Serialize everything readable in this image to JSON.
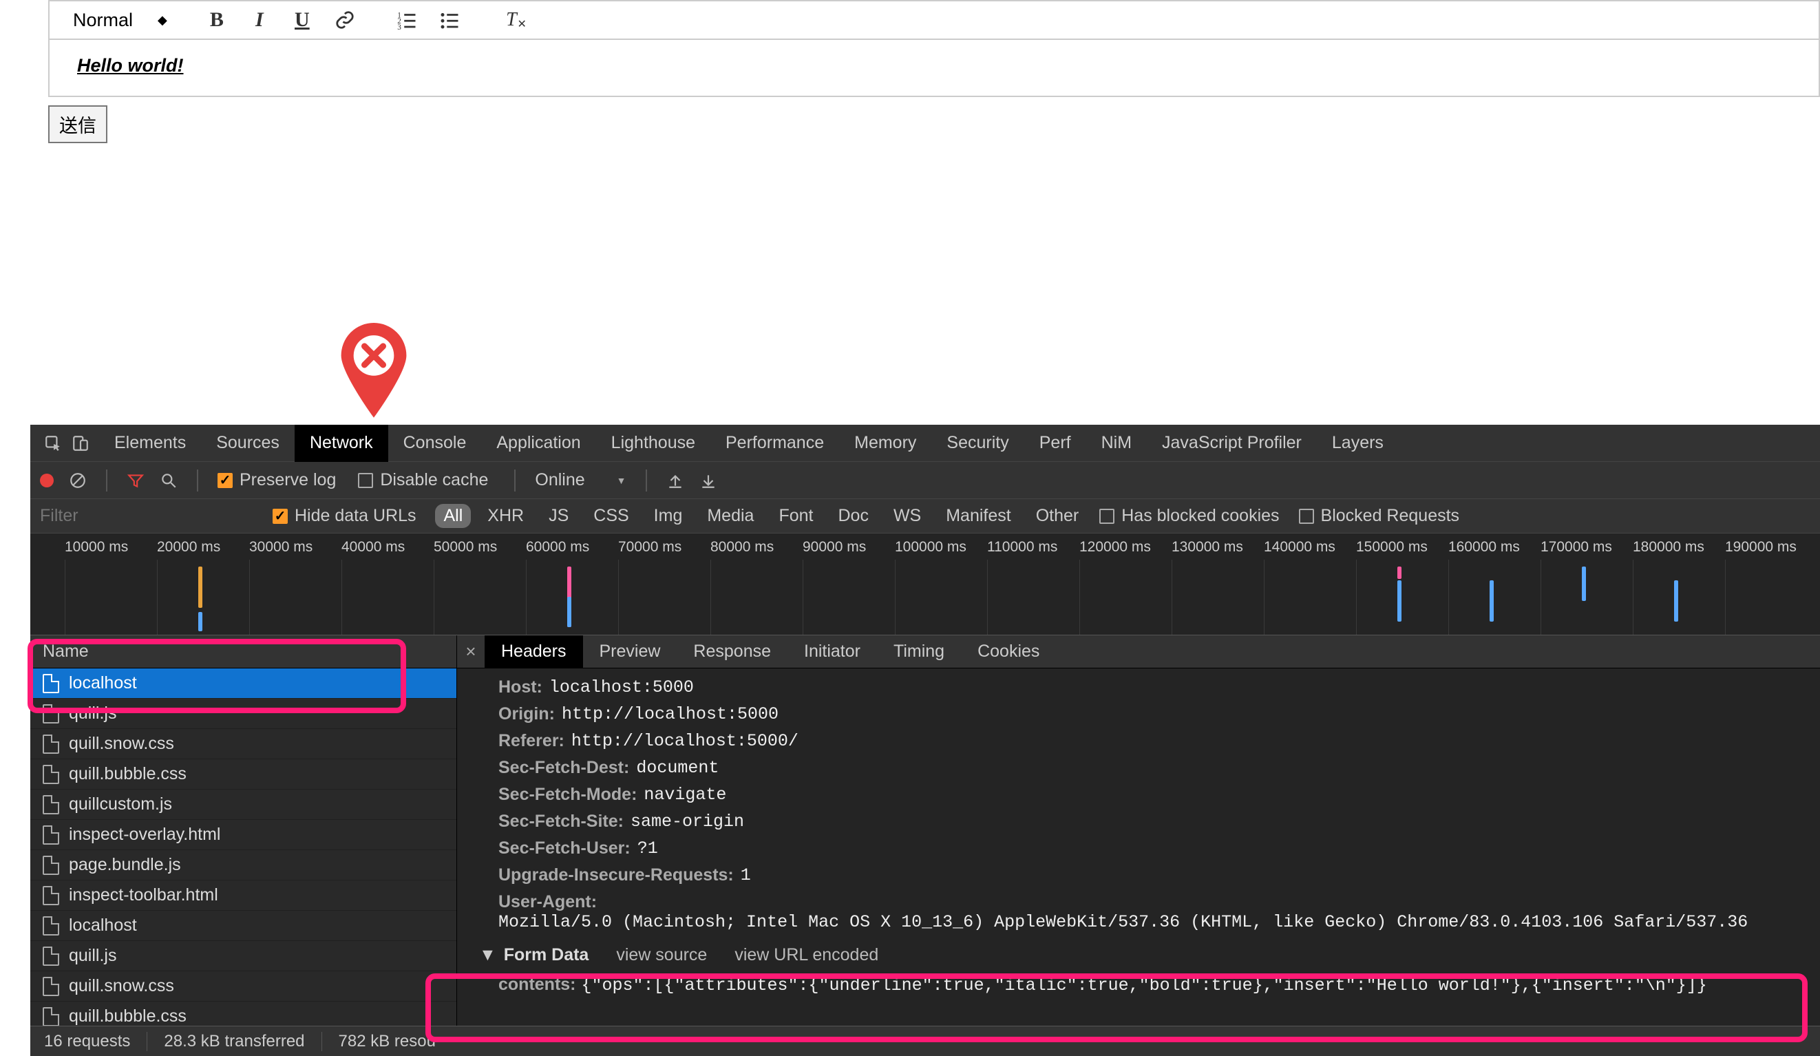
{
  "editor": {
    "format_label": "Normal",
    "content": "Hello world!",
    "submit_label": "送信"
  },
  "devtools": {
    "tabs": [
      "Elements",
      "Sources",
      "Network",
      "Console",
      "Application",
      "Lighthouse",
      "Performance",
      "Memory",
      "Security",
      "Perf",
      "NiM",
      "JavaScript Profiler",
      "Layers"
    ],
    "active_tab": "Network",
    "toolbar": {
      "preserve_log_label": "Preserve log",
      "preserve_log_checked": true,
      "disable_cache_label": "Disable cache",
      "disable_cache_checked": false,
      "throttle_label": "Online"
    },
    "filterbar": {
      "filter_placeholder": "Filter",
      "hide_data_urls_label": "Hide data URLs",
      "hide_data_urls_checked": true,
      "types": [
        "All",
        "XHR",
        "JS",
        "CSS",
        "Img",
        "Media",
        "Font",
        "Doc",
        "WS",
        "Manifest",
        "Other"
      ],
      "active_type": "All",
      "has_blocked_cookies_label": "Has blocked cookies",
      "blocked_requests_label": "Blocked Requests"
    },
    "timeline": {
      "ticks": [
        "10000 ms",
        "20000 ms",
        "30000 ms",
        "40000 ms",
        "50000 ms",
        "60000 ms",
        "70000 ms",
        "80000 ms",
        "90000 ms",
        "100000 ms",
        "110000 ms",
        "120000 ms",
        "130000 ms",
        "140000 ms",
        "150000 ms",
        "160000 ms",
        "170000 ms",
        "180000 ms",
        "190000 ms"
      ]
    },
    "requests": {
      "header": "Name",
      "selected_index": 0,
      "items": [
        "localhost",
        "quill.js",
        "quill.snow.css",
        "quill.bubble.css",
        "quillcustom.js",
        "inspect-overlay.html",
        "page.bundle.js",
        "inspect-toolbar.html",
        "localhost",
        "quill.js",
        "quill.snow.css",
        "quill.bubble.css"
      ]
    },
    "detail": {
      "tabs": [
        "Headers",
        "Preview",
        "Response",
        "Initiator",
        "Timing",
        "Cookies"
      ],
      "active_tab": "Headers",
      "headers": [
        {
          "k": "Host:",
          "v": "localhost:5000"
        },
        {
          "k": "Origin:",
          "v": "http://localhost:5000"
        },
        {
          "k": "Referer:",
          "v": "http://localhost:5000/"
        },
        {
          "k": "Sec-Fetch-Dest:",
          "v": "document"
        },
        {
          "k": "Sec-Fetch-Mode:",
          "v": "navigate"
        },
        {
          "k": "Sec-Fetch-Site:",
          "v": "same-origin"
        },
        {
          "k": "Sec-Fetch-User:",
          "v": "?1"
        },
        {
          "k": "Upgrade-Insecure-Requests:",
          "v": "1"
        },
        {
          "k": "User-Agent:",
          "v": "Mozilla/5.0 (Macintosh; Intel Mac OS X 10_13_6) AppleWebKit/537.36 (KHTML, like Gecko) Chrome/83.0.4103.106 Safari/537.36"
        }
      ],
      "form_data_title": "Form Data",
      "view_source_label": "view source",
      "view_url_encoded_label": "view URL encoded",
      "form_data": {
        "k": "contents:",
        "v": "{\"ops\":[{\"attributes\":{\"underline\":true,\"italic\":true,\"bold\":true},\"insert\":\"Hello world!\"},{\"insert\":\"\\n\"}]}"
      }
    },
    "status": {
      "requests": "16 requests",
      "transferred": "28.3 kB transferred",
      "resources": "782 kB resou"
    }
  }
}
